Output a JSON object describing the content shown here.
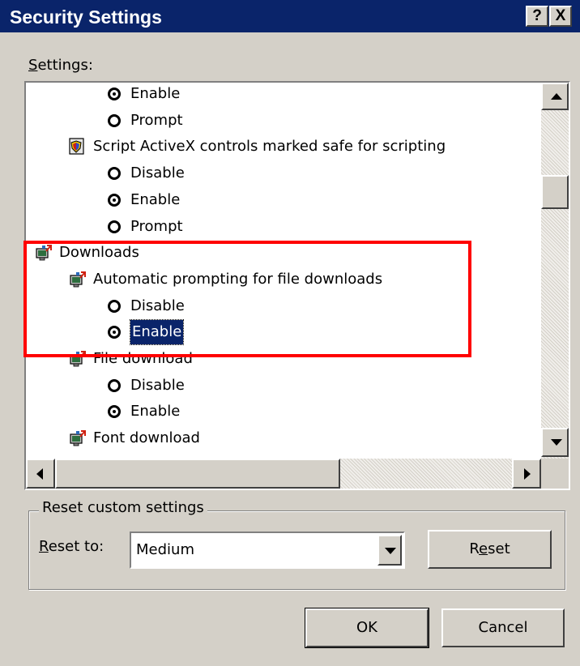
{
  "window": {
    "title": "Security Settings",
    "help_button": "?",
    "close_button": "X"
  },
  "settings_label": {
    "prefix": "S",
    "rest": "ettings:"
  },
  "tree": [
    {
      "type": "radio",
      "label": "Enable",
      "checked": true
    },
    {
      "type": "radio",
      "label": "Prompt",
      "checked": false
    },
    {
      "type": "category",
      "icon": "shield-icon",
      "label": "Script ActiveX controls marked safe for scripting"
    },
    {
      "type": "radio",
      "label": "Disable",
      "checked": false
    },
    {
      "type": "radio",
      "label": "Enable",
      "checked": true
    },
    {
      "type": "radio",
      "label": "Prompt",
      "checked": false
    },
    {
      "type": "category",
      "icon": "downloads-icon",
      "label": "Downloads"
    },
    {
      "type": "category",
      "icon": "downloads-icon",
      "label": "Automatic prompting for file downloads"
    },
    {
      "type": "radio",
      "label": "Disable",
      "checked": false
    },
    {
      "type": "radio",
      "label": "Enable",
      "checked": true,
      "selected": true
    },
    {
      "type": "category",
      "icon": "downloads-icon",
      "label": "File download"
    },
    {
      "type": "radio",
      "label": "Disable",
      "checked": false
    },
    {
      "type": "radio",
      "label": "Enable",
      "checked": true
    },
    {
      "type": "category",
      "icon": "downloads-icon",
      "label": "Font download"
    }
  ],
  "reset_group": {
    "legend": "Reset custom settings",
    "reset_to_prefix": "R",
    "reset_to_rest": "eset to:",
    "combo_value": "Medium",
    "reset_button_pre": "R",
    "reset_button_u": "e",
    "reset_button_post": "set"
  },
  "buttons": {
    "ok": "OK",
    "cancel": "Cancel"
  },
  "highlight": {
    "color": "#ff0000"
  }
}
